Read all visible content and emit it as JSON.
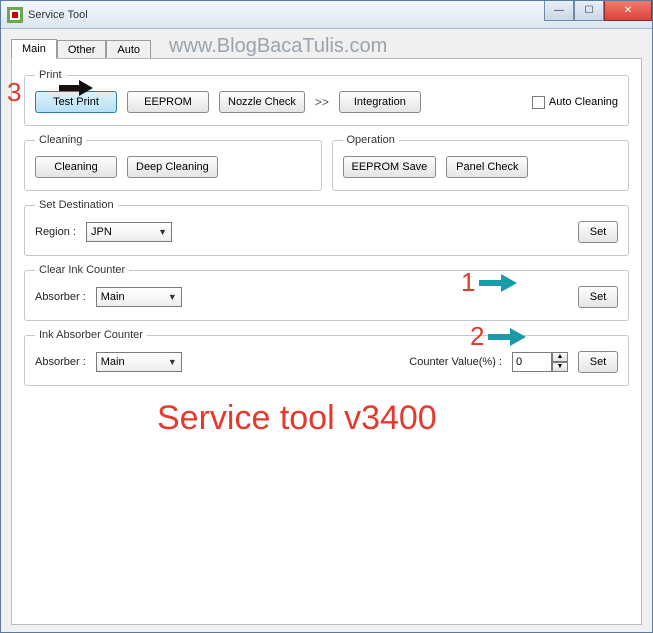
{
  "window": {
    "title": "Service Tool"
  },
  "tabs": {
    "items": [
      "Main",
      "Other",
      "Auto"
    ],
    "active": 0
  },
  "watermark": "www.BlogBacaTulis.com",
  "print": {
    "legend": "Print",
    "test": "Test Print",
    "eeprom": "EEPROM",
    "nozzle": "Nozzle Check",
    "chev": ">>",
    "integration": "Integration",
    "autoclean": "Auto Cleaning"
  },
  "cleaning": {
    "legend": "Cleaning",
    "cleaning": "Cleaning",
    "deep": "Deep Cleaning"
  },
  "operation": {
    "legend": "Operation",
    "eepromsave": "EEPROM Save",
    "panel": "Panel Check"
  },
  "setdest": {
    "legend": "Set Destination",
    "regionLabel": "Region :",
    "region": "JPN",
    "set": "Set"
  },
  "clearink": {
    "legend": "Clear Ink Counter",
    "absorberLabel": "Absorber :",
    "absorber": "Main",
    "set": "Set"
  },
  "inkabs": {
    "legend": "Ink Absorber Counter",
    "absorberLabel": "Absorber :",
    "absorber": "Main",
    "counterLabel": "Counter Value(%) :",
    "counterValue": "0",
    "set": "Set"
  },
  "overlay": {
    "title": "Service tool v3400",
    "n1": "1",
    "n2": "2",
    "n3": "3"
  }
}
